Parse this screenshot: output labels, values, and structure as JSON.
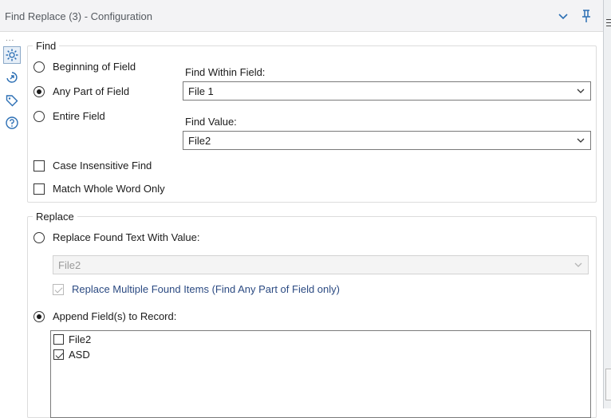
{
  "window": {
    "title": "Find Replace (3) - Configuration"
  },
  "nav": {
    "more": "...",
    "icons": [
      "gear-icon",
      "anchor-arrow-icon",
      "tag-icon",
      "help-icon"
    ]
  },
  "find": {
    "legend": "Find",
    "options": [
      {
        "label": "Beginning of Field",
        "checked": false
      },
      {
        "label": "Any Part of Field",
        "checked": true
      },
      {
        "label": "Entire Field",
        "checked": false
      }
    ],
    "find_within_label": "Find Within Field:",
    "find_within_value": "File 1",
    "find_value_label": "Find Value:",
    "find_value_value": "File2",
    "case_insensitive_label": "Case Insensitive Find",
    "case_insensitive_checked": false,
    "match_whole_word_label": "Match Whole Word Only",
    "match_whole_word_checked": false
  },
  "replace": {
    "legend": "Replace",
    "replace_found_label": "Replace Found Text With Value:",
    "replace_found_checked": false,
    "replace_value": "File2",
    "replace_multiple_label": "Replace Multiple Found Items (Find Any Part of Field only)",
    "replace_multiple_checked": true,
    "append_label": "Append Field(s) to Record:",
    "append_checked": true,
    "fields": [
      {
        "label": "File2",
        "checked": false
      },
      {
        "label": "ASD",
        "checked": true
      }
    ]
  },
  "colors": {
    "accent": "#2c6fb4",
    "title_bar": "#f3f3f5",
    "border": "#dcdcdc"
  }
}
